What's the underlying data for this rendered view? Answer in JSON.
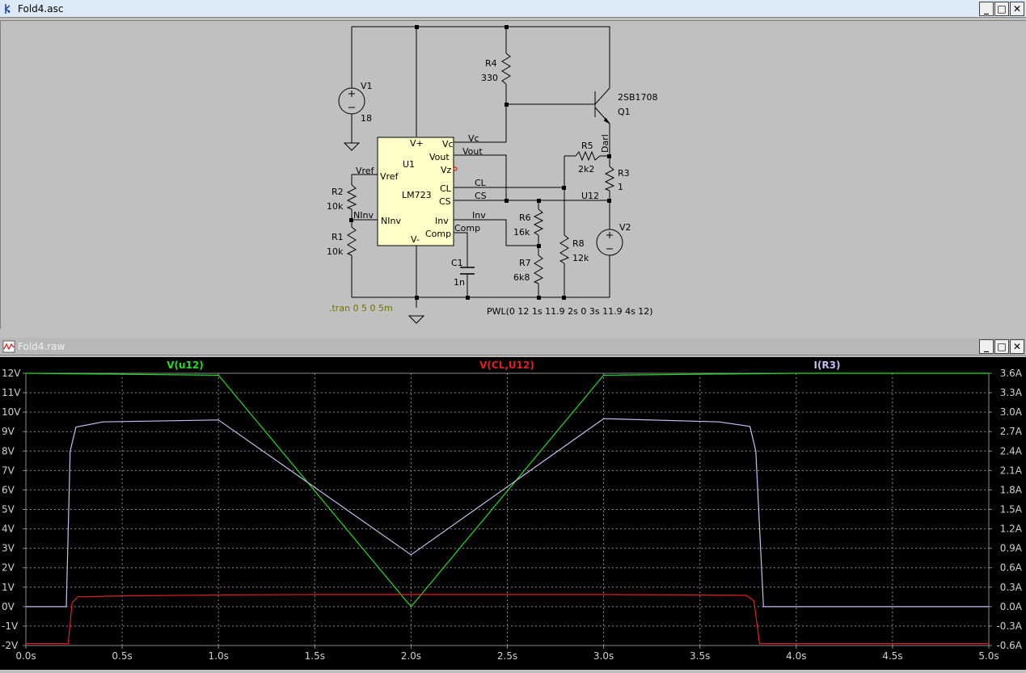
{
  "schematic": {
    "title": "Fold4.asc",
    "components": {
      "V1": {
        "name": "V1",
        "value": "18"
      },
      "V2": {
        "name": "V2"
      },
      "R1": {
        "name": "R1",
        "value": "10k"
      },
      "R2": {
        "name": "R2",
        "value": "10k"
      },
      "R3": {
        "name": "R3",
        "value": "1"
      },
      "R4": {
        "name": "R4",
        "value": "330"
      },
      "R5": {
        "name": "R5",
        "value": "2k2"
      },
      "R6": {
        "name": "R6",
        "value": "16k"
      },
      "R7": {
        "name": "R7",
        "value": "6k8"
      },
      "R8": {
        "name": "R8",
        "value": "12k"
      },
      "C1": {
        "name": "C1",
        "value": "1n"
      },
      "Q1": {
        "name": "Q1",
        "part": "2SB1708"
      },
      "U1": {
        "name": "U1",
        "part": "LM723",
        "pins": {
          "vplus": "V+",
          "vc": "Vc",
          "vout": "Vout",
          "vz": "Vz",
          "vref": "Vref",
          "cl": "CL",
          "cs": "CS",
          "ninv": "NInv",
          "inv": "Inv",
          "comp": "Comp",
          "vminus": "V-"
        }
      }
    },
    "nets": {
      "vc": "Vc",
      "vout": "Vout",
      "vref": "Vref",
      "cl": "CL",
      "cs": "CS",
      "ninv": "NInv",
      "inv": "Inv",
      "comp": "Comp",
      "u12": "U12",
      "darl": "Darl"
    },
    "directives": {
      "tran": ".tran 0 5 0 5m",
      "pwl": "PWL(0 12 1s 11.9 2s 0 3s 11.9 4s 12)"
    }
  },
  "plot": {
    "title": "Fold4.raw",
    "colors": {
      "green": "#22dd22",
      "red": "#e02020",
      "lavender": "#c8bdf0",
      "grid": "#8a8a8a",
      "axis_text": "#d0d0d0"
    },
    "chart_data": {
      "type": "line",
      "xlabel": "",
      "ylabel": "",
      "xlim": [
        0,
        5
      ],
      "ylim_left": [
        -2,
        12
      ],
      "ylim_right": [
        -0.6,
        3.6
      ],
      "grid": true,
      "x_ticks": [
        "0.0s",
        "0.5s",
        "1.0s",
        "1.5s",
        "2.0s",
        "2.5s",
        "3.0s",
        "3.5s",
        "4.0s",
        "4.5s",
        "5.0s"
      ],
      "y_left_ticks": [
        "12V",
        "11V",
        "10V",
        "9V",
        "8V",
        "7V",
        "6V",
        "5V",
        "4V",
        "3V",
        "2V",
        "1V",
        "0V",
        "-1V",
        "-2V"
      ],
      "y_right_ticks": [
        "3.6A",
        "3.3A",
        "3.0A",
        "2.7A",
        "2.4A",
        "2.1A",
        "1.8A",
        "1.5A",
        "1.2A",
        "0.9A",
        "0.6A",
        "0.3A",
        "0.0A",
        "-0.3A",
        "-0.6A"
      ],
      "series": [
        {
          "name": "V(u12)",
          "axis": "left",
          "color": "#22dd22",
          "x": [
            0,
            1.0,
            2.0,
            3.0,
            4.0,
            5.0
          ],
          "y": [
            12,
            11.9,
            0,
            11.9,
            12,
            12
          ]
        },
        {
          "name": "V(CL,U12)",
          "axis": "left",
          "color": "#e02020",
          "x": [
            0,
            0.22,
            0.24,
            0.27,
            0.5,
            1.0,
            1.5,
            2.0,
            2.5,
            3.0,
            3.5,
            3.74,
            3.78,
            3.81,
            5.0
          ],
          "y": [
            -1.9,
            -1.9,
            0.2,
            0.5,
            0.55,
            0.6,
            0.62,
            0.62,
            0.62,
            0.62,
            0.6,
            0.58,
            0.3,
            -1.9,
            -1.9
          ]
        },
        {
          "name": "I(R3)",
          "axis": "right",
          "color": "#c8bdf0",
          "x": [
            0,
            0.21,
            0.23,
            0.26,
            0.4,
            1.0,
            2.0,
            3.0,
            3.6,
            3.76,
            3.79,
            3.83,
            5.0
          ],
          "y": [
            0,
            0,
            2.4,
            2.77,
            2.85,
            2.88,
            0.8,
            2.9,
            2.85,
            2.78,
            2.4,
            0,
            0
          ]
        }
      ]
    }
  }
}
